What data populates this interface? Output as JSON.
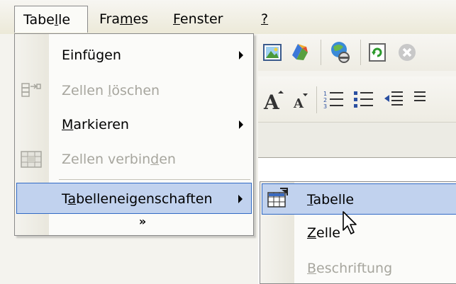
{
  "menubar": {
    "items": [
      {
        "label": "Tabelle",
        "underline_char": "l",
        "open": true
      },
      {
        "label": "Frames",
        "underline_char": "m"
      },
      {
        "label": "Fenster",
        "underline_char": "F"
      },
      {
        "label": "?",
        "underline_char": "?"
      }
    ]
  },
  "tabelle_menu": {
    "items": [
      {
        "label": "Einfügen",
        "underline_char": "g",
        "enabled": true,
        "has_submenu": true,
        "icon": ""
      },
      {
        "label": "Zellen löschen",
        "underline_char": "l",
        "enabled": false,
        "has_submenu": false,
        "icon": "delete-cells-icon"
      },
      {
        "label": "Markieren",
        "underline_char": "M",
        "enabled": true,
        "has_submenu": true,
        "icon": ""
      },
      {
        "label": "Zellen verbinden",
        "underline_char": "d",
        "enabled": false,
        "has_submenu": false,
        "icon": "merge-cells-icon"
      },
      {
        "label": "Tabelleneigenschaften",
        "underline_char": "a",
        "enabled": true,
        "has_submenu": true,
        "highlighted": true,
        "icon": ""
      }
    ],
    "expand_label": "»"
  },
  "properties_submenu": {
    "items": [
      {
        "label": "Tabelle",
        "underline_char": "T",
        "enabled": true,
        "highlighted": true,
        "icon": "table-properties-icon"
      },
      {
        "label": "Zelle",
        "underline_char": "Z",
        "enabled": true
      },
      {
        "label": "Beschriftung",
        "underline_char": "B",
        "enabled": false
      }
    ]
  },
  "colors": {
    "highlight_fill": "#c1d2ee",
    "highlight_border": "#316ac5",
    "disabled_text": "#a7a69e"
  }
}
